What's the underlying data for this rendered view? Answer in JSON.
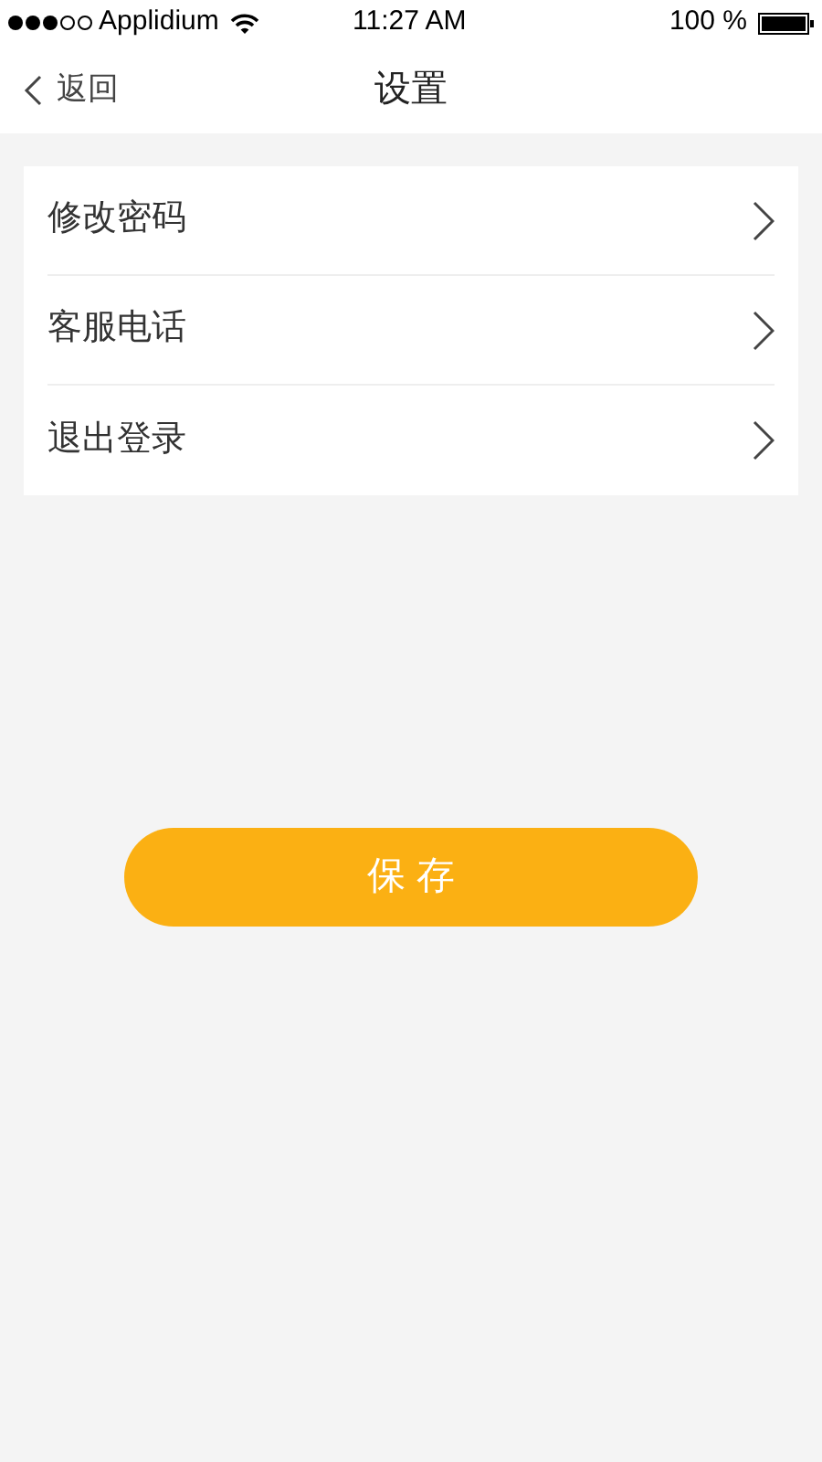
{
  "status_bar": {
    "carrier": "Applidium",
    "time": "11:27 AM",
    "battery": "100 %"
  },
  "nav_bar": {
    "back": "返回",
    "title": "设置"
  },
  "menu_items": [
    {
      "label": "修改密码"
    },
    {
      "label": "客服电话"
    },
    {
      "label": "退出登录"
    }
  ],
  "save_button": "保 存"
}
